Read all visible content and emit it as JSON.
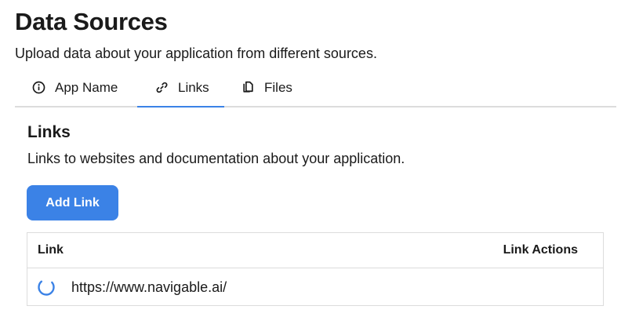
{
  "header": {
    "title": "Data Sources",
    "subtitle": "Upload data about your application from different sources."
  },
  "tabs": [
    {
      "label": "App Name",
      "icon": "info-circle-icon",
      "active": false
    },
    {
      "label": "Links",
      "icon": "link-icon",
      "active": true
    },
    {
      "label": "Files",
      "icon": "files-icon",
      "active": false
    }
  ],
  "links_section": {
    "title": "Links",
    "description": "Links to websites and documentation about your application.",
    "add_button_label": "Add Link",
    "table": {
      "columns": [
        "Link",
        "Link Actions"
      ],
      "rows": [
        {
          "url": "https://www.navigable.ai/",
          "status": "loading"
        }
      ]
    }
  },
  "colors": {
    "accent": "#3b82e6",
    "border": "#dcdcdc",
    "text": "#1a1a1a"
  }
}
